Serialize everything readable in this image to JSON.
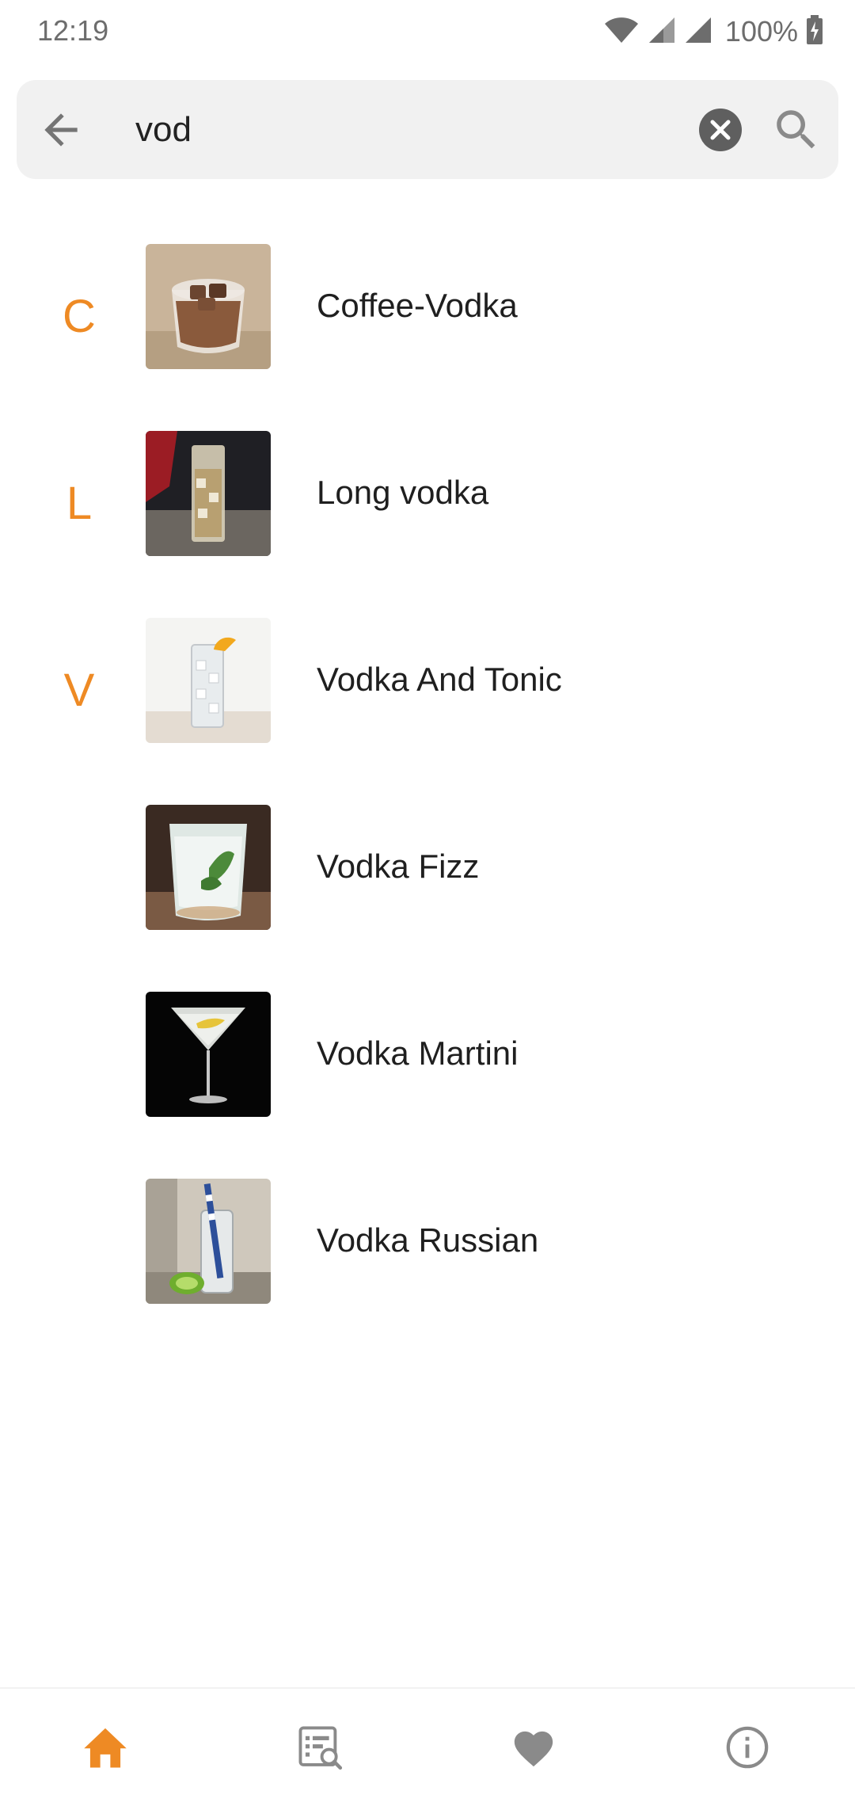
{
  "status_bar": {
    "time": "12:19",
    "battery": "100%"
  },
  "search": {
    "query": "vod"
  },
  "results": [
    {
      "section": "C",
      "name": "Coffee-Vodka",
      "image": "coffee-vodka-photo"
    },
    {
      "section": "L",
      "name": "Long vodka",
      "image": "long-vodka-photo"
    },
    {
      "section": "V",
      "name": "Vodka And Tonic",
      "image": "vodka-and-tonic-photo"
    },
    {
      "section": "",
      "name": "Vodka Fizz",
      "image": "vodka-fizz-photo"
    },
    {
      "section": "",
      "name": "Vodka Martini",
      "image": "vodka-martini-photo"
    },
    {
      "section": "",
      "name": "Vodka Russian",
      "image": "vodka-russian-photo"
    }
  ],
  "bottom_nav": {
    "items": [
      "home-icon",
      "search-list-icon",
      "heart-icon",
      "info-icon"
    ],
    "active": "home-icon"
  },
  "colors": {
    "accent": "#ee8a24",
    "icon_gray": "#8a8a8a",
    "search_bg": "#f1f1f1"
  }
}
